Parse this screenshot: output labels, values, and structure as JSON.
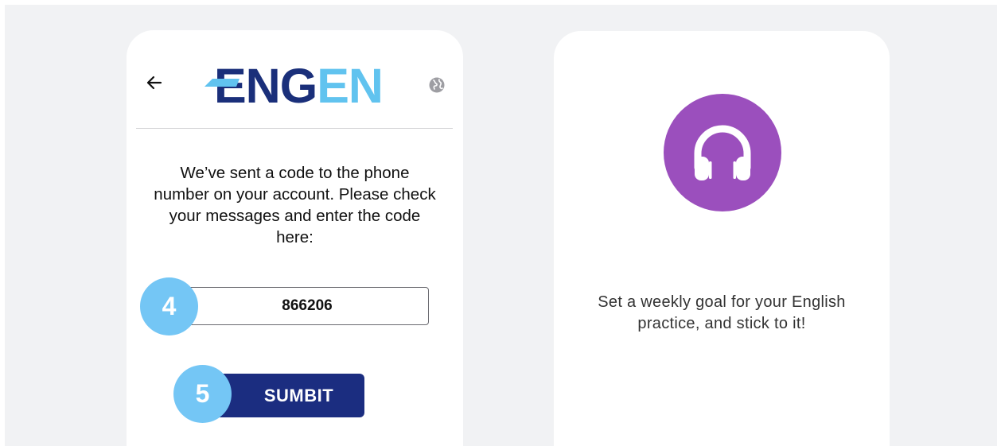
{
  "login_card": {
    "logo": {
      "part_dark": "ENG",
      "part_light": "EN"
    },
    "back_icon": "arrow-left-icon",
    "language_icon": "globe-icon",
    "message": "We’ve sent a code to the phone number on your account. Please check your messages and enter the code here:",
    "code_input": {
      "value": "866206"
    },
    "submit_button": {
      "label": "SUMBIT"
    },
    "step_badges": {
      "code_step": "4",
      "submit_step": "5"
    }
  },
  "info_card": {
    "icon": "headphones-icon",
    "text": "Set a weekly goal for your English practice, and stick to it!"
  },
  "colors": {
    "background": "#f1f2f4",
    "brand_dark_blue": "#1b2d80",
    "brand_light_blue": "#61c3ef",
    "step_badge": "#74c6f5",
    "headphones_circle": "#9b4fbd"
  }
}
